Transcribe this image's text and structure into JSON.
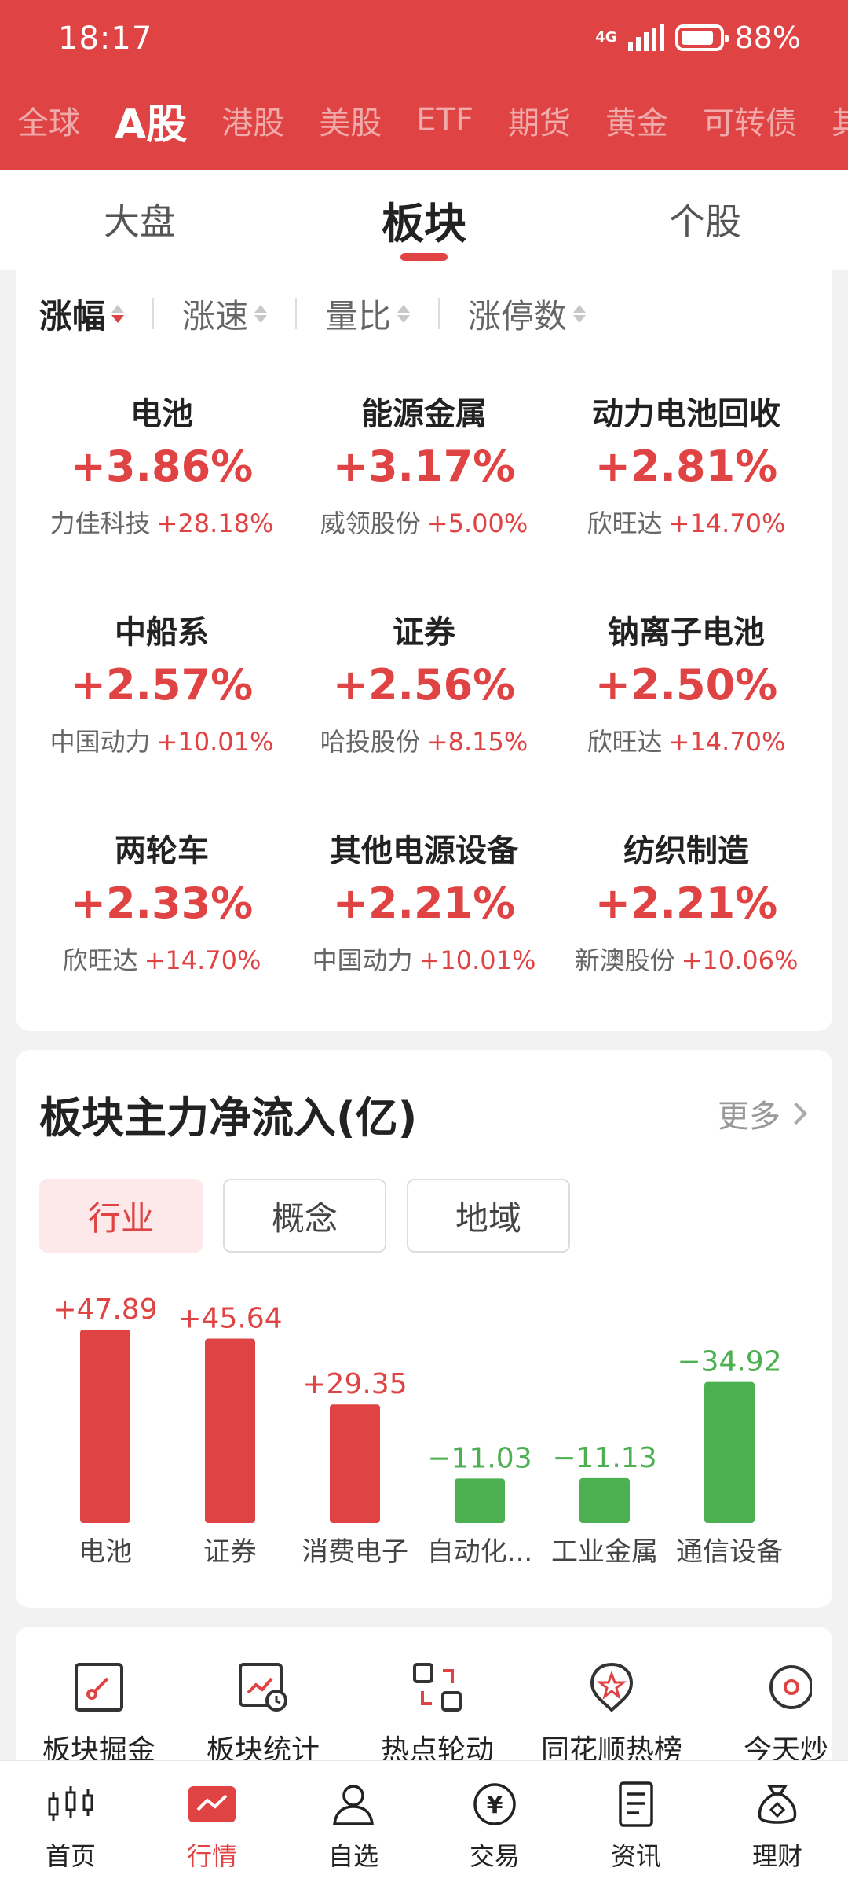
{
  "status": {
    "time": "18:17",
    "network": "4G",
    "battery": "88%"
  },
  "market_tabs": [
    "全球",
    "A股",
    "港股",
    "美股",
    "ETF",
    "期货",
    "黄金",
    "可转债",
    "其"
  ],
  "market_active_index": 1,
  "sub_tabs": [
    "大盘",
    "板块",
    "个股"
  ],
  "sub_active_index": 1,
  "sort_options": [
    "涨幅",
    "涨速",
    "量比",
    "涨停数"
  ],
  "sectors": [
    {
      "name": "电池",
      "pct": "+3.86%",
      "stock": "力佳科技",
      "stock_pct": "+28.18%"
    },
    {
      "name": "能源金属",
      "pct": "+3.17%",
      "stock": "威领股份",
      "stock_pct": "+5.00%"
    },
    {
      "name": "动力电池回收",
      "pct": "+2.81%",
      "stock": "欣旺达",
      "stock_pct": "+14.70%"
    },
    {
      "name": "中船系",
      "pct": "+2.57%",
      "stock": "中国动力",
      "stock_pct": "+10.01%"
    },
    {
      "name": "证券",
      "pct": "+2.56%",
      "stock": "哈投股份",
      "stock_pct": "+8.15%"
    },
    {
      "name": "钠离子电池",
      "pct": "+2.50%",
      "stock": "欣旺达",
      "stock_pct": "+14.70%"
    },
    {
      "name": "两轮车",
      "pct": "+2.33%",
      "stock": "欣旺达",
      "stock_pct": "+14.70%"
    },
    {
      "name": "其他电源设备",
      "pct": "+2.21%",
      "stock": "中国动力",
      "stock_pct": "+10.01%"
    },
    {
      "name": "纺织制造",
      "pct": "+2.21%",
      "stock": "新澳股份",
      "stock_pct": "+10.06%"
    }
  ],
  "fund_flow": {
    "title": "板块主力净流入(亿)",
    "more": "更多",
    "pills": [
      "行业",
      "概念",
      "地域"
    ],
    "active_pill": 0
  },
  "chart_data": {
    "type": "bar",
    "categories": [
      "电池",
      "证券",
      "消费电子",
      "自动化...",
      "工业金属",
      "通信设备"
    ],
    "values": [
      47.89,
      45.64,
      29.35,
      -11.03,
      -11.13,
      -34.92
    ],
    "value_labels": [
      "+47.89",
      "+45.64",
      "+29.35",
      "−11.03",
      "−11.13",
      "−34.92"
    ],
    "colors": {
      "positive": "#e04343",
      "negative": "#4caf50"
    }
  },
  "tools": [
    "板块掘金",
    "板块统计",
    "热点轮动",
    "同花顺热榜",
    "今天炒"
  ],
  "tool_icons": [
    "chart-dig-icon",
    "stats-clock-icon",
    "rotate-icon",
    "hot-rank-icon",
    "today-icon"
  ],
  "bottom_nav": [
    "首页",
    "行情",
    "自选",
    "交易",
    "资讯",
    "理财"
  ],
  "bottom_nav_active": 1,
  "colors": {
    "brand": "#e04343",
    "up": "#e04343",
    "down": "#4caf50"
  }
}
